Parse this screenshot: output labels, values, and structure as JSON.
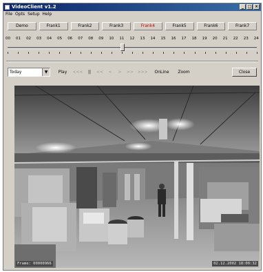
{
  "window": {
    "title": "VideoClient v1.2",
    "buttons": [
      "_",
      "□",
      "×"
    ]
  },
  "menu": [
    "File",
    "Opts",
    "Setup",
    "Help"
  ],
  "frames": [
    {
      "label": "Demo",
      "active": false
    },
    {
      "label": "Frank1",
      "active": false
    },
    {
      "label": "Frank2",
      "active": false
    },
    {
      "label": "Frank3",
      "active": false
    },
    {
      "label": "Frank4",
      "active": true
    },
    {
      "label": "Frank5",
      "active": false
    },
    {
      "label": "Frank6",
      "active": false
    },
    {
      "label": "Frank7",
      "active": false
    }
  ],
  "timeline": {
    "hours": [
      "00",
      "01",
      "02",
      "03",
      "04",
      "05",
      "06",
      "07",
      "08",
      "09",
      "10",
      "11",
      "12",
      "13",
      "14",
      "15",
      "16",
      "17",
      "18",
      "19",
      "20",
      "21",
      "22",
      "23",
      "24"
    ],
    "position_hour": 11
  },
  "controls": {
    "date_value": "Today",
    "play": "Play",
    "step_labels": [
      "<<<",
      "||",
      "<<",
      "<",
      ">",
      ">>",
      ">>>"
    ],
    "online": "OnLine",
    "zoom": "Zoom",
    "close": "Close"
  },
  "video": {
    "frame_label": "Frame: 00000966",
    "timestamp": "02.12.2002 18:00:32"
  },
  "colors": {
    "titlebar_start": "#0a246a",
    "titlebar_end": "#3a6ea5",
    "active_tab": "#c00000",
    "chrome": "#d4d0c8"
  }
}
